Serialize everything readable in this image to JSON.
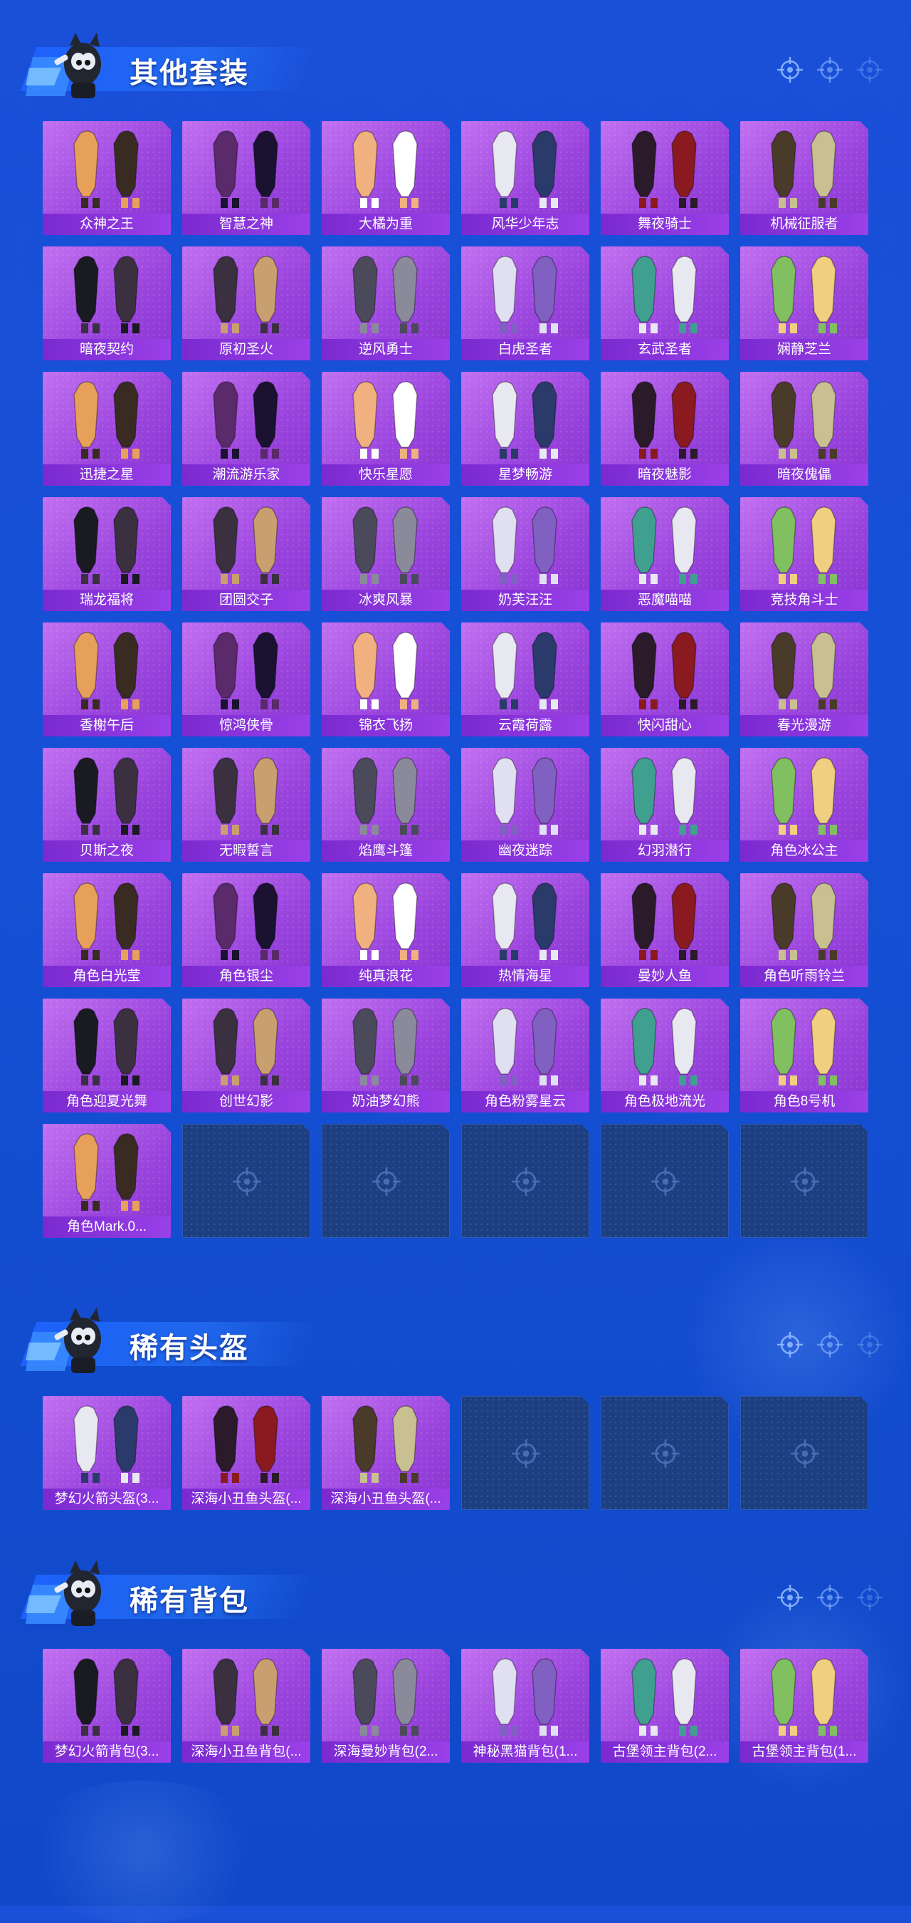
{
  "sections": [
    {
      "title": "其他套装",
      "items": [
        "众神之王",
        "智慧之神",
        "大橘为重",
        "风华少年志",
        "舞夜骑士",
        "机械征服者",
        "暗夜契约",
        "原初圣火",
        "逆风勇士",
        "白虎圣者",
        "玄武圣者",
        "娴静芝兰",
        "迅捷之星",
        "潮流游乐家",
        "快乐星愿",
        "星梦畅游",
        "暗夜魅影",
        "暗夜傀儡",
        "瑞龙福将",
        "团圆交子",
        "冰爽风暴",
        "奶芙汪汪",
        "恶魔喵喵",
        "竞技角斗士",
        "香榭午后",
        "惊鸿侠骨",
        "锦衣飞扬",
        "云霞荷露",
        "快闪甜心",
        "春光漫游",
        "贝斯之夜",
        "无暇誓言",
        "焰鹰斗篷",
        "幽夜迷踪",
        "幻羽潜行",
        "角色冰公主",
        "角色白光莹",
        "角色银尘",
        "纯真浪花",
        "热情海星",
        "曼妙人鱼",
        "角色听雨铃兰",
        "角色迎夏光舞",
        "创世幻影",
        "奶油梦幻熊",
        "角色粉雾星云",
        "角色极地流光",
        "角色8号机",
        "角色Mark.0..."
      ],
      "empty_slots": 5
    },
    {
      "title": "稀有头盔",
      "items": [
        "梦幻火箭头盔(3...",
        "深海小丑鱼头盔(...",
        "深海小丑鱼头盔(..."
      ],
      "empty_slots": 3
    },
    {
      "title": "稀有背包",
      "items": [
        "梦幻火箭背包(3...",
        "深海小丑鱼背包(...",
        "深海曼妙背包(2...",
        "神秘黑猫背包(1...",
        "古堡领主背包(2...",
        "古堡领主背包(1..."
      ],
      "empty_slots": 0
    }
  ],
  "colors": {
    "background": "#1550d6",
    "card": "#9a44de",
    "card_label": "#7a2ad0",
    "empty_slot": "#1d3e80"
  },
  "icons": [
    "mascot-icon",
    "crosshair-icon"
  ]
}
